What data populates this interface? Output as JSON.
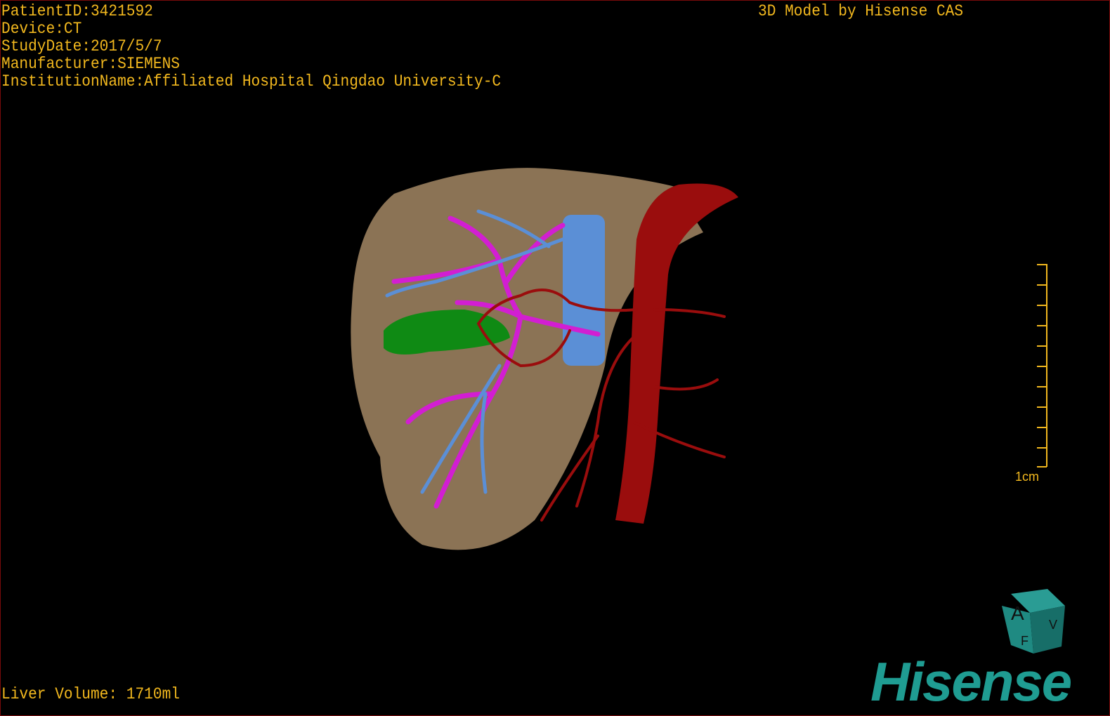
{
  "overlay": {
    "patient_id": "PatientID:3421592",
    "device": "Device:CT",
    "study_date": "StudyDate:2017/5/7",
    "manufacturer": "Manufacturer:SIEMENS",
    "institution": "InstitutionName:Affiliated Hospital Qingdao University-C",
    "brand_text": "3D Model by Hisense CAS",
    "liver_volume": "Liver Volume: 1710ml"
  },
  "scale_bar": {
    "label": "1cm"
  },
  "orientation_cube": {
    "faces": [
      "A",
      "V",
      "F"
    ],
    "color": "#1f9c92"
  },
  "logo": {
    "text": "Hisense",
    "color": "#1f9c92"
  },
  "colors": {
    "text": "#f2b81e",
    "liver": "#8b7355",
    "portal_vein": "#d21ed2",
    "hepatic_vein": "#5b8fd6",
    "artery_aorta": "#9a0d0d",
    "gallbladder": "#0f8a14"
  }
}
